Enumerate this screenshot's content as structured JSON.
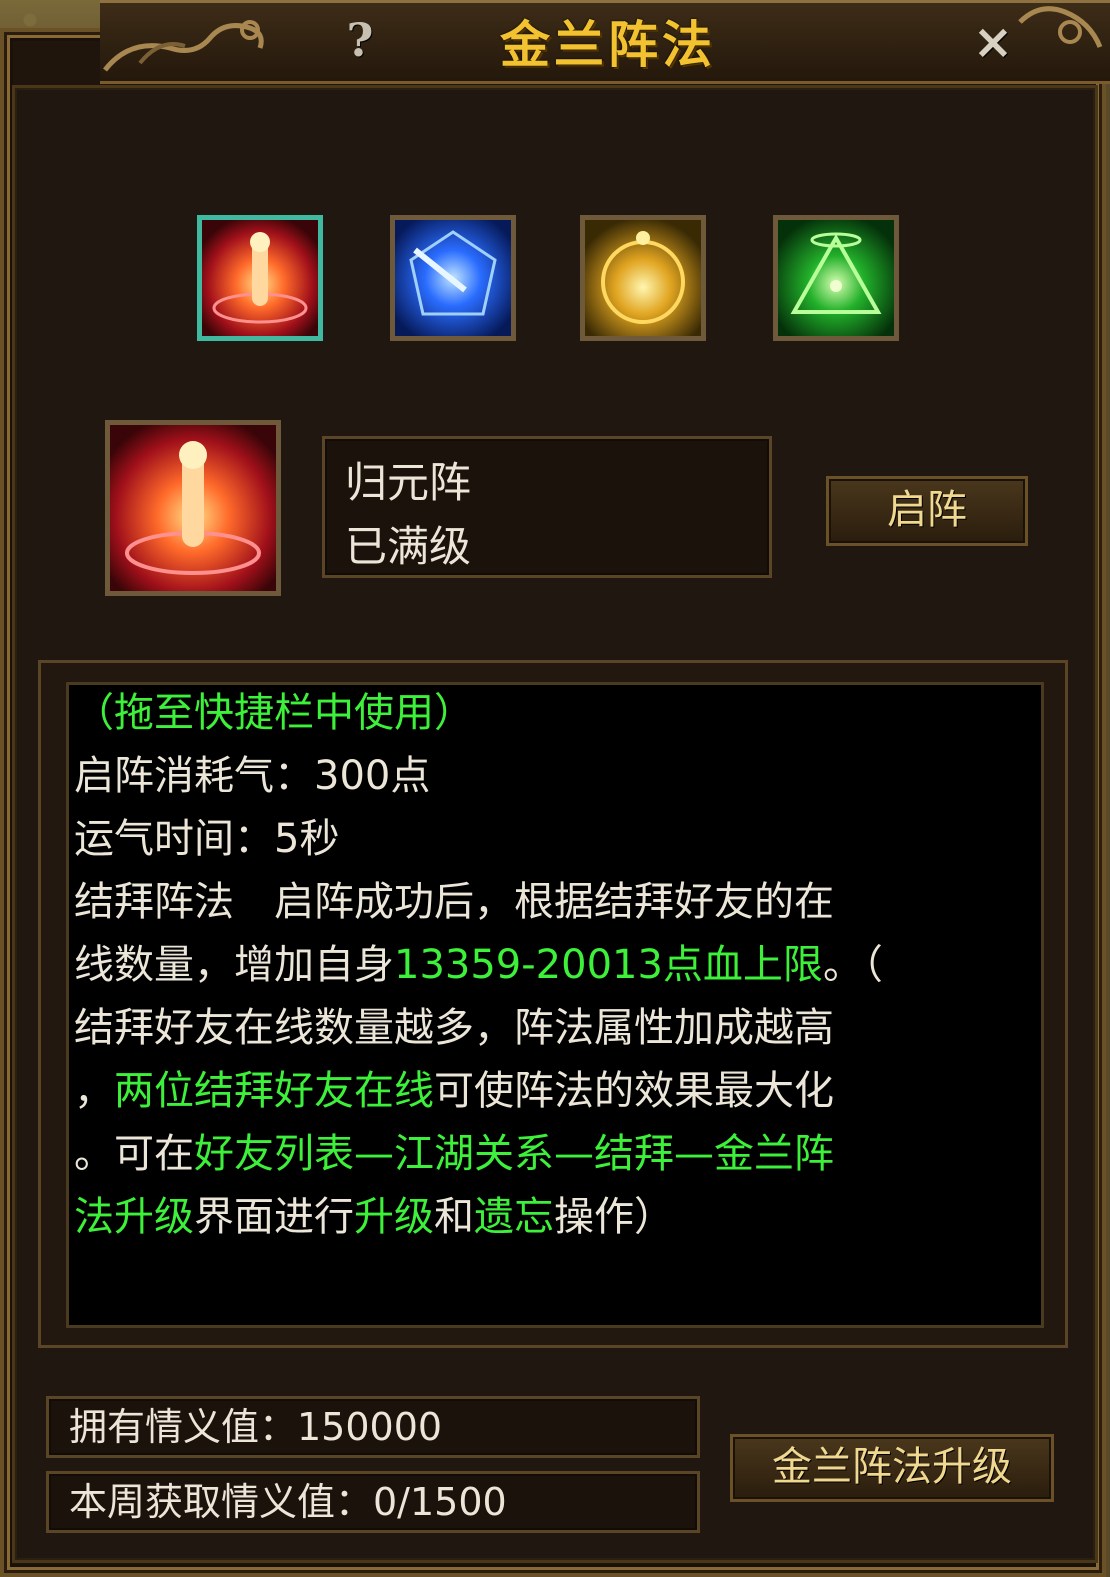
{
  "window": {
    "title": "金兰阵法",
    "help_label": "?",
    "close_label": "×"
  },
  "formations": [
    {
      "name": "归元阵",
      "icon": "red-pillar-formation-icon",
      "selected": true
    },
    {
      "name": "",
      "icon": "blue-star-formation-icon",
      "selected": false
    },
    {
      "name": "",
      "icon": "gold-orb-formation-icon",
      "selected": false
    },
    {
      "name": "",
      "icon": "green-triangle-formation-icon",
      "selected": false
    }
  ],
  "selected": {
    "name": "归元阵",
    "level_status": "已满级",
    "activate_label": "启阵"
  },
  "description": {
    "lines": [
      [
        {
          "t": "（拖至快捷栏中使用）",
          "g": true
        }
      ],
      [
        {
          "t": "启阵消耗气：300点",
          "g": false
        }
      ],
      [
        {
          "t": "运气时间：5秒",
          "g": false
        }
      ],
      [
        {
          "t": "结拜阵法　启阵成功后，根据结拜好友的在",
          "g": false
        }
      ],
      [
        {
          "t": "线数量，增加自身",
          "g": false
        },
        {
          "t": "13359-20013点血上限",
          "g": true
        },
        {
          "t": "。（",
          "g": false
        }
      ],
      [
        {
          "t": "结拜好友在线数量越多，阵法属性加成越高",
          "g": false
        }
      ],
      [
        {
          "t": "，",
          "g": false
        },
        {
          "t": "两位结拜好友在线",
          "g": true
        },
        {
          "t": "可使阵法的效果最大化",
          "g": false
        }
      ],
      [
        {
          "t": "。可在",
          "g": false
        },
        {
          "t": "好友列表—江湖关系—结拜—金兰阵",
          "g": true
        }
      ],
      [
        {
          "t": "法升级",
          "g": true
        },
        {
          "t": "界面进行",
          "g": false
        },
        {
          "t": "升级",
          "g": true
        },
        {
          "t": "和",
          "g": false
        },
        {
          "t": "遗忘",
          "g": true
        },
        {
          "t": "操作）",
          "g": false
        }
      ]
    ]
  },
  "stats": {
    "owned_label": "拥有情义值：150000",
    "weekly_label": "本周获取情义值：0/1500"
  },
  "upgrade_button_label": "金兰阵法升级",
  "colors": {
    "title": "#f2c230",
    "highlight_green": "#3df03a",
    "body_text": "#ece6d8",
    "selected_border": "#3fb9a0"
  }
}
